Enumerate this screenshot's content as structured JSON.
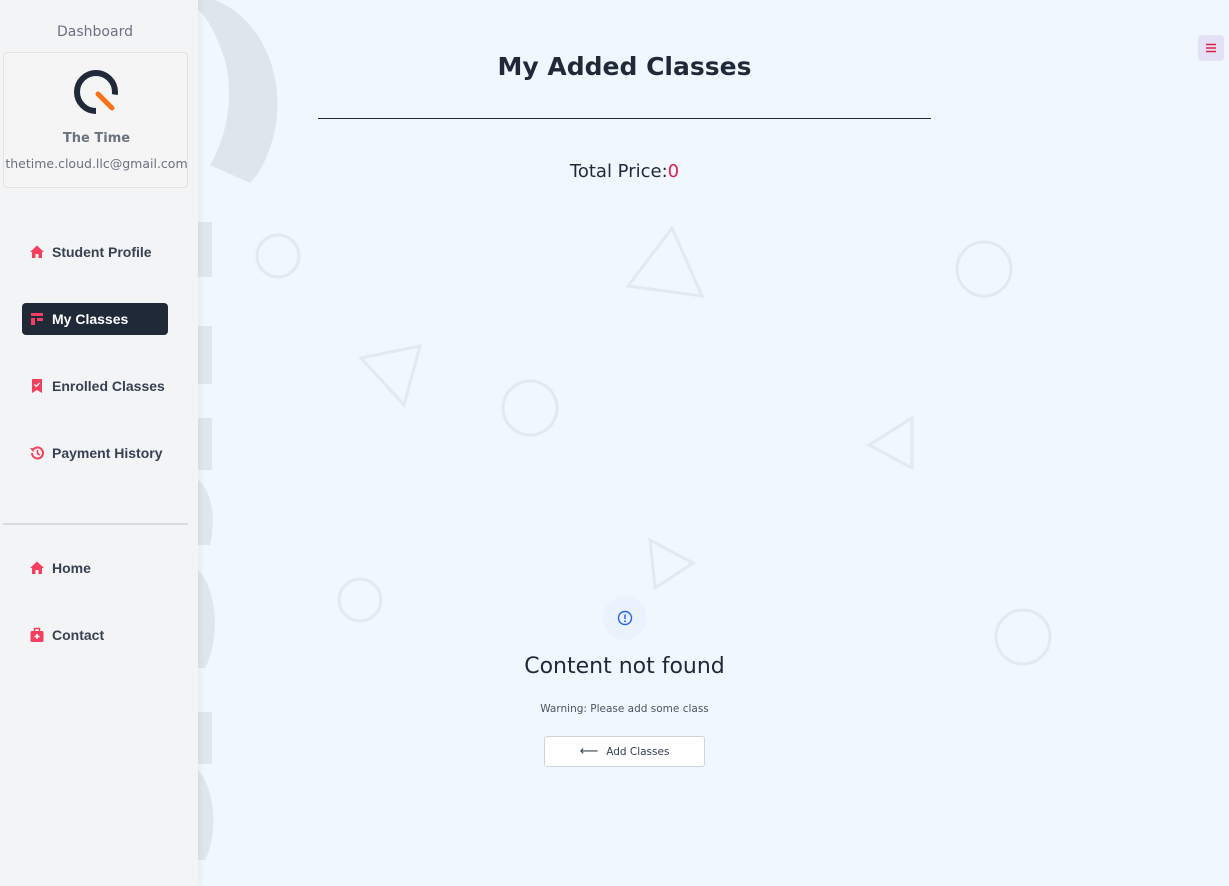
{
  "sidebar": {
    "title": "Dashboard",
    "profile": {
      "name": "The Time",
      "email": "thetime.cloud.llc@gmail.com"
    },
    "nav_items": [
      {
        "label": "Student Profile",
        "icon": "home-icon",
        "active": false
      },
      {
        "label": "My Classes",
        "icon": "classes-icon",
        "active": true
      },
      {
        "label": "Enrolled Classes",
        "icon": "bookmark-icon",
        "active": false
      },
      {
        "label": "Payment History",
        "icon": "history-icon",
        "active": false
      }
    ],
    "footer_items": [
      {
        "label": "Home",
        "icon": "home-icon"
      },
      {
        "label": "Contact",
        "icon": "medical-bag-icon"
      }
    ]
  },
  "main": {
    "title": "My Added Classes",
    "total_label": "Total Price:",
    "total_value": "0",
    "empty": {
      "title": "Content not found",
      "warning": "Warning: Please add some class",
      "button_label": "Add Classes",
      "icon": "info-icon"
    }
  },
  "menu_button": {
    "icon": "hamburger-icon"
  },
  "colors": {
    "accent": "#e11d48",
    "active_bg": "#1f2937",
    "page_bg": "#f0f7ff",
    "sidebar_bg": "#f3f4f6"
  }
}
